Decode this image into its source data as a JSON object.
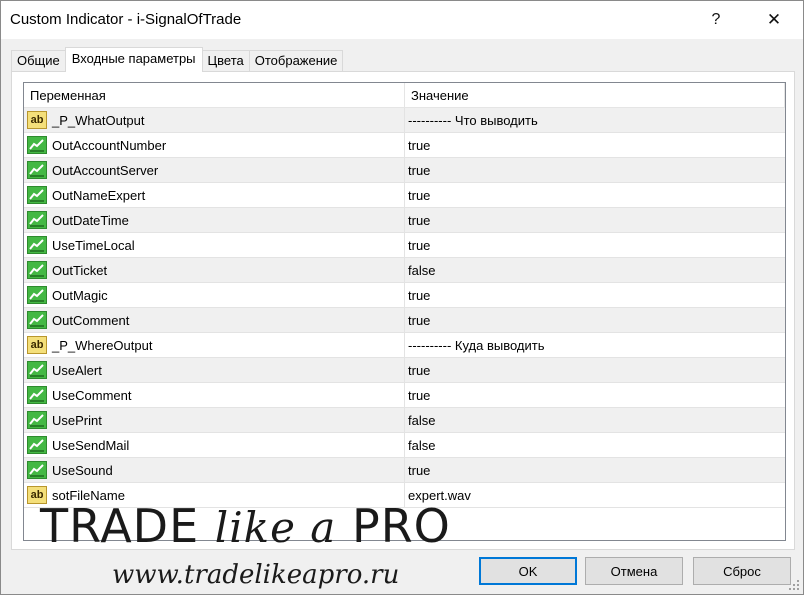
{
  "window": {
    "title": "Custom Indicator - i-SignalOfTrade",
    "help_glyph": "?",
    "close_glyph": "✕"
  },
  "tabs": [
    {
      "label": "Общие",
      "active": false
    },
    {
      "label": "Входные параметры",
      "active": true
    },
    {
      "label": "Цвета",
      "active": false
    },
    {
      "label": "Отображение",
      "active": false
    }
  ],
  "grid": {
    "columns": {
      "variable": "Переменная",
      "value": "Значение"
    },
    "rows": [
      {
        "icon": "string-ab-icon",
        "name": "_P_WhatOutput",
        "value": "---------- Что выводить"
      },
      {
        "icon": "bool-icon",
        "name": "OutAccountNumber",
        "value": "true"
      },
      {
        "icon": "bool-icon",
        "name": "OutAccountServer",
        "value": "true"
      },
      {
        "icon": "bool-icon",
        "name": "OutNameExpert",
        "value": "true"
      },
      {
        "icon": "bool-icon",
        "name": "OutDateTime",
        "value": "true"
      },
      {
        "icon": "bool-icon",
        "name": "UseTimeLocal",
        "value": "true"
      },
      {
        "icon": "bool-icon",
        "name": "OutTicket",
        "value": "false"
      },
      {
        "icon": "bool-icon",
        "name": "OutMagic",
        "value": "true"
      },
      {
        "icon": "bool-icon",
        "name": "OutComment",
        "value": "true"
      },
      {
        "icon": "string-ab-icon",
        "name": "_P_WhereOutput",
        "value": "---------- Куда выводить"
      },
      {
        "icon": "bool-icon",
        "name": "UseAlert",
        "value": "true"
      },
      {
        "icon": "bool-icon",
        "name": "UseComment",
        "value": "true"
      },
      {
        "icon": "bool-icon",
        "name": "UsePrint",
        "value": "false"
      },
      {
        "icon": "bool-icon",
        "name": "UseSendMail",
        "value": "false"
      },
      {
        "icon": "bool-icon",
        "name": "UseSound",
        "value": "true"
      },
      {
        "icon": "string-ab-icon",
        "name": "sotFileName",
        "value": "expert.wav"
      }
    ],
    "ab_icon_text": "ab"
  },
  "buttons": {
    "ok": "OK",
    "cancel": "Отмена",
    "reset": "Сброс"
  },
  "watermark": {
    "brand_left": "TRADE ",
    "brand_italic": "like a",
    "brand_right": " PRO",
    "url": "www.tradelikeapro.ru"
  },
  "colors": {
    "accent": "#0078d7",
    "bool_icon": "#44b844",
    "string_icon": "#f4df7a",
    "alt_row": "#f0f0f0"
  }
}
